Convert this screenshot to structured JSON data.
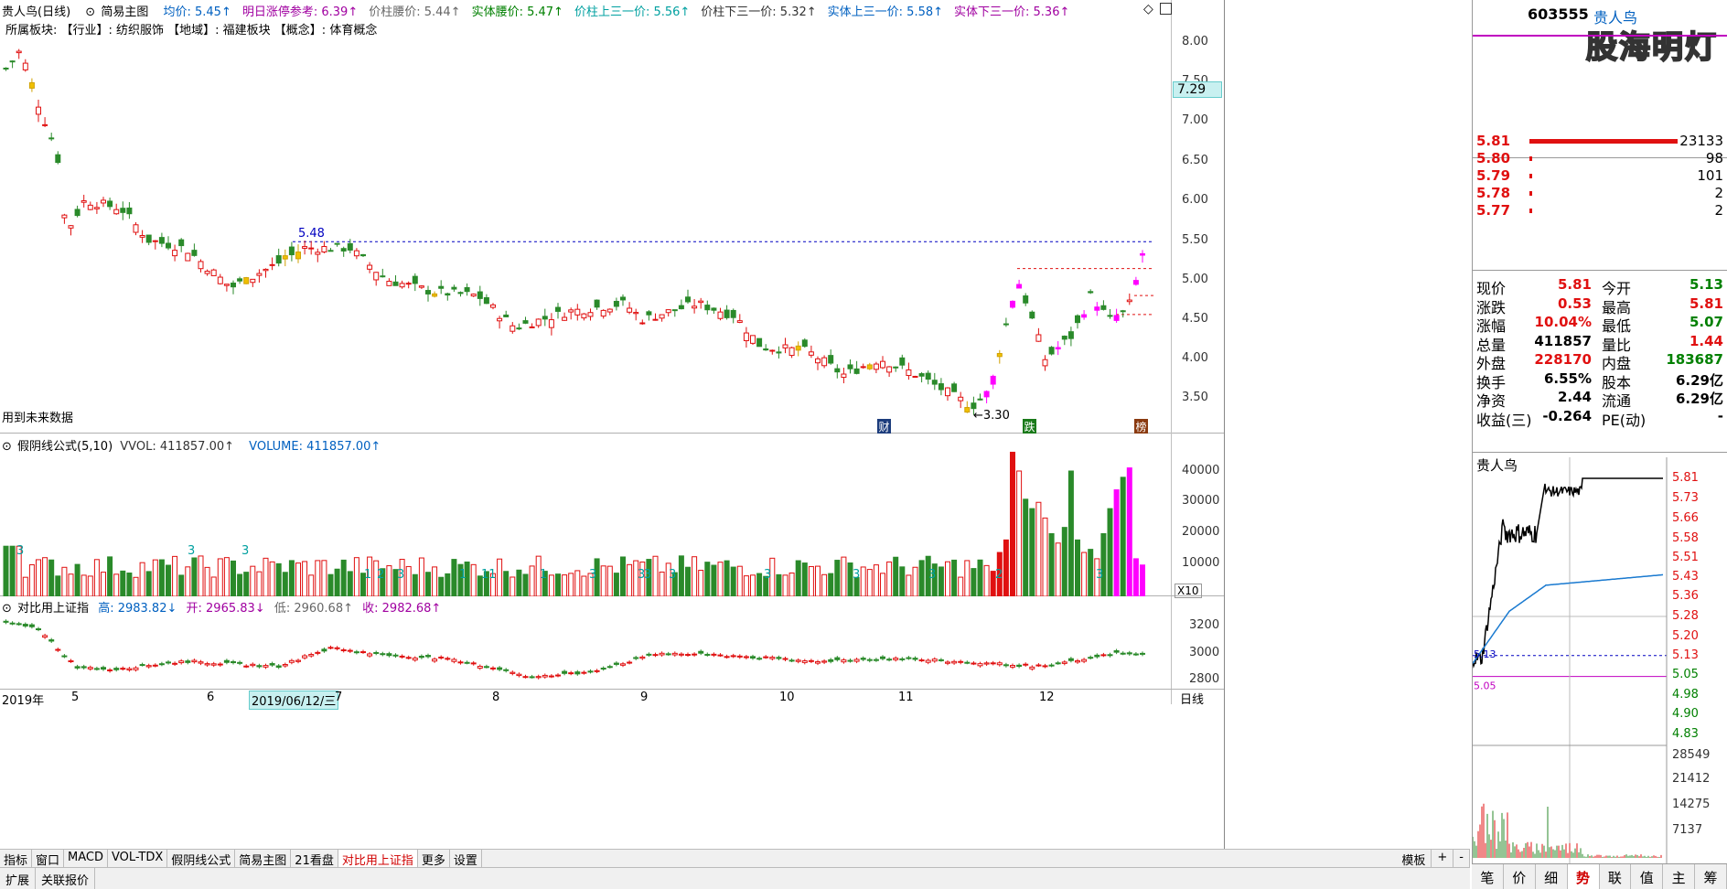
{
  "main_chart": {
    "title": "贵人鸟(日线)",
    "indicator_name": "简易主图",
    "info_items": [
      {
        "label": "均价: 5.45↑",
        "color": "#0060c0"
      },
      {
        "label": "明日涨停参考: 6.39↑",
        "color": "#a000a0"
      },
      {
        "label": "价柱腰价: 5.44↑",
        "color": "#666666"
      },
      {
        "label": "实体腰价: 5.47↑",
        "color": "#008000"
      },
      {
        "label": "价柱上三一价: 5.56↑",
        "color": "#00a0a0"
      },
      {
        "label": "价柱下三一价: 5.32↑",
        "color": "#333333"
      },
      {
        "label": "实体上三一价: 5.58↑",
        "color": "#0060c0"
      },
      {
        "label": "实体下三一价: 5.36↑",
        "color": "#a000a0"
      }
    ],
    "sector_line": "所属板块:    【行业】: 纺织服饰    【地域】: 福建板块    【概念】: 体育概念",
    "future_data_note": "用到未来数据",
    "price_axis": [
      "8.00",
      "7.50",
      "7.00",
      "6.50",
      "6.00",
      "5.50",
      "5.00",
      "4.50",
      "4.00",
      "3.50"
    ],
    "current_price_tag": "7.29",
    "high_mark": "5.48",
    "low_mark": "3.30",
    "markers": [
      "财",
      "跌",
      "榜"
    ]
  },
  "volume_chart": {
    "title": "假阴线公式(5,10)",
    "vvol": "VVOL: 411857.00↑",
    "volume": "VOLUME: 411857.00↑",
    "axis": [
      "40000",
      "30000",
      "20000",
      "10000"
    ],
    "unit": "X10",
    "counter_labels": [
      "3",
      "3",
      "3",
      "1",
      "2",
      "3",
      "1",
      "11",
      "1",
      "3",
      "3",
      "3",
      "3",
      "3",
      "3",
      "3",
      "2",
      "3"
    ]
  },
  "index_chart": {
    "title": "对比用上证指",
    "high": "高: 2983.82↓",
    "open": "开: 2965.83↓",
    "low": "低: 2960.68↑",
    "close": "收: 2982.68↑",
    "axis": [
      "3200",
      "3000",
      "2800"
    ]
  },
  "date_axis": [
    "2019年",
    "5",
    "6",
    "2019/06/12/三",
    "7",
    "8",
    "9",
    "10",
    "11",
    "12"
  ],
  "date_axis_right": "日线",
  "tabs": [
    "指标",
    "窗口",
    "MACD",
    "VOL-TDX",
    "假阴线公式",
    "简易主图",
    "21看盘",
    "对比用上证指",
    "更多",
    "设置"
  ],
  "active_tab": "对比用上证指",
  "tabs_right": [
    "模板",
    "+",
    "-"
  ],
  "status": [
    "扩展",
    "关联报价"
  ],
  "quote": {
    "code": "603555",
    "name": "贵人鸟",
    "watermark": "股海明灯",
    "orderbook": [
      {
        "price": "5.81",
        "volume": "23133",
        "barfrac": 1.0
      },
      {
        "price": "5.80",
        "volume": "98",
        "barfrac": 0.01
      },
      {
        "price": "5.79",
        "volume": "101",
        "barfrac": 0.01
      },
      {
        "price": "5.78",
        "volume": "2",
        "barfrac": 0.005
      },
      {
        "price": "5.77",
        "volume": "2",
        "barfrac": 0.005
      }
    ],
    "stats": [
      {
        "l1": "现价",
        "v1": "5.81",
        "l2": "今开",
        "v2": "5.13",
        "c1": "#e01010",
        "c2": "#008000"
      },
      {
        "l1": "涨跌",
        "v1": "0.53",
        "l2": "最高",
        "v2": "5.81",
        "c1": "#e01010",
        "c2": "#e01010"
      },
      {
        "l1": "涨幅",
        "v1": "10.04%",
        "l2": "最低",
        "v2": "5.07",
        "c1": "#e01010",
        "c2": "#008000"
      },
      {
        "l1": "总量",
        "v1": "411857",
        "l2": "量比",
        "v2": "1.44",
        "c1": "#000000",
        "c2": "#e01010"
      },
      {
        "l1": "外盘",
        "v1": "228170",
        "l2": "内盘",
        "v2": "183687",
        "c1": "#e01010",
        "c2": "#008000"
      },
      {
        "l1": "换手",
        "v1": "6.55%",
        "l2": "股本",
        "v2": "6.29亿",
        "c1": "#000000",
        "c2": "#000000"
      },
      {
        "l1": "净资",
        "v1": "2.44",
        "l2": "流通",
        "v2": "6.29亿",
        "c1": "#000000",
        "c2": "#000000"
      },
      {
        "l1": "收益(三)",
        "v1": "-0.264",
        "l2": "PE(动)",
        "v2": "-",
        "c1": "#000000",
        "c2": "#000000"
      }
    ],
    "intraday_title": "贵人鸟",
    "intraday_axis": [
      "5.81",
      "5.73",
      "5.66",
      "5.58",
      "5.51",
      "5.43",
      "5.36",
      "5.28",
      "5.20",
      "5.13",
      "5.05",
      "4.98",
      "4.90",
      "4.83"
    ],
    "intraday_vol_axis": [
      "28549",
      "21412",
      "14275",
      "7137"
    ],
    "intraday_marks": [
      "5.13",
      "5.05"
    ],
    "bottom_tabs": [
      "笔",
      "价",
      "细",
      "势",
      "联",
      "值",
      "主",
      "筹"
    ],
    "active_bottom_tab": "势"
  }
}
